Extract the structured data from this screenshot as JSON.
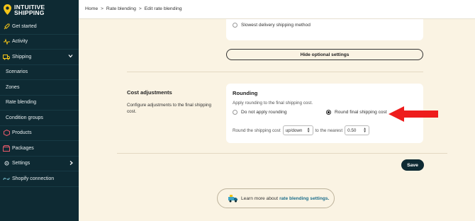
{
  "app": {
    "logo_line1": "INTUITIVE",
    "logo_line2": "SHIPPING",
    "brand_color": "#0e2a33",
    "accent": "#f5c518"
  },
  "sidebar": {
    "items": [
      {
        "label": "Get started",
        "icon": "rocket-icon"
      },
      {
        "label": "Activity",
        "icon": "pulse-icon"
      },
      {
        "label": "Shipping",
        "icon": "truck-icon"
      },
      {
        "label": "Scenarios"
      },
      {
        "label": "Zones"
      },
      {
        "label": "Rate blending"
      },
      {
        "label": "Condition groups"
      },
      {
        "label": "Products",
        "icon": "box-icon"
      },
      {
        "label": "Packages",
        "icon": "package-icon"
      },
      {
        "label": "Settings",
        "icon": "gear-icon"
      },
      {
        "label": "Shopify connection",
        "icon": "link-icon"
      }
    ]
  },
  "breadcrumb": {
    "home": "Home",
    "sep": ">",
    "rate_blending": "Rate blending",
    "current": "Edit rate blending"
  },
  "optional": {
    "slowest_label": "Slowest delivery shipping method",
    "hide_button": "Hide optional settings"
  },
  "cost_adjustments": {
    "title": "Cost adjustments",
    "description": "Configure adjustments to the final shipping cost."
  },
  "rounding": {
    "title": "Rounding",
    "help": "Apply rounding to the final shipping cost.",
    "option_none": "Do not apply rounding",
    "option_round": "Round final shipping cost",
    "selected": "option_round",
    "row_prefix": "Round the shipping cost",
    "direction_value": "up/down",
    "row_middle": "to the nearest",
    "nearest_value": "0.50"
  },
  "actions": {
    "save": "Save"
  },
  "learn": {
    "prefix": "Learn more about",
    "link": "rate blending settings."
  }
}
